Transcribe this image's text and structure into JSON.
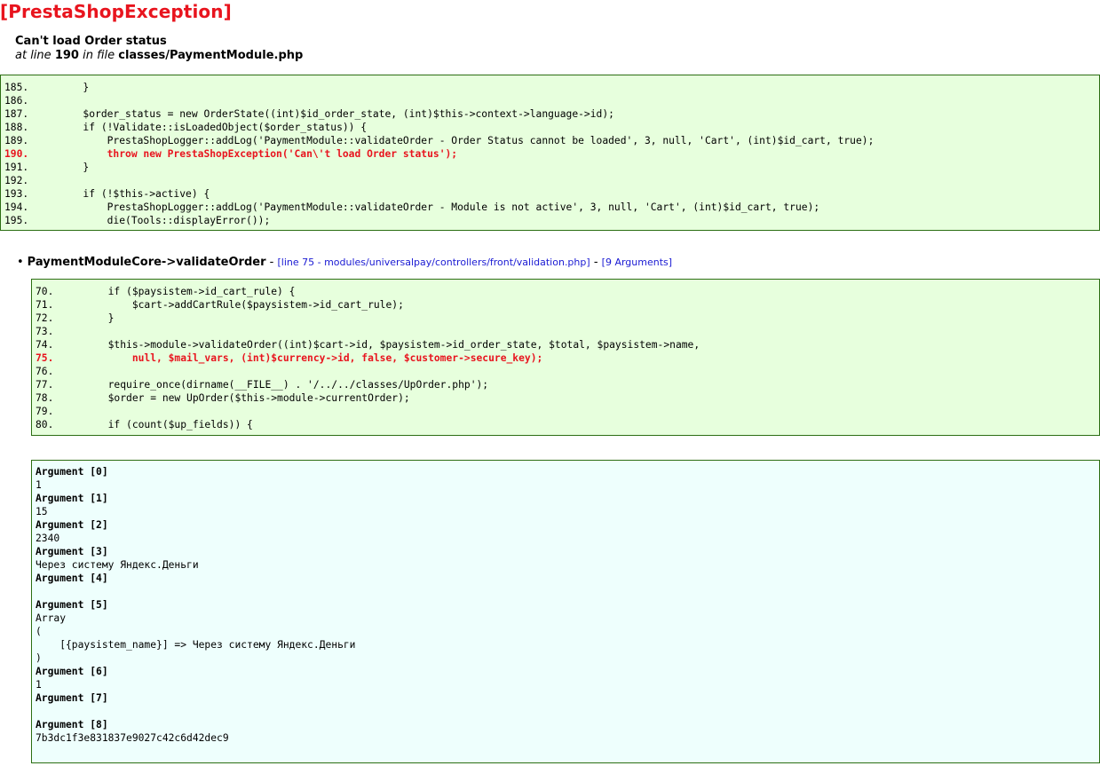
{
  "exception": {
    "title": "[PrestaShopException]",
    "message": "Can't load Order status",
    "at_line_prefix": "at line",
    "line": "190",
    "in_file_prefix": "in file",
    "file": "classes/PaymentModule.php"
  },
  "source_block_1": [
    {
      "text": "185.         }",
      "error": false
    },
    {
      "text": "186.",
      "error": false
    },
    {
      "text": "187.         $order_status = new OrderState((int)$id_order_state, (int)$this->context->language->id);",
      "error": false
    },
    {
      "text": "188.         if (!Validate::isLoadedObject($order_status)) {",
      "error": false
    },
    {
      "text": "189.             PrestaShopLogger::addLog('PaymentModule::validateOrder - Order Status cannot be loaded', 3, null, 'Cart', (int)$id_cart, true);",
      "error": false
    },
    {
      "text": "190.             throw new PrestaShopException('Can\\'t load Order status');",
      "error": true
    },
    {
      "text": "191.         }",
      "error": false
    },
    {
      "text": "192.",
      "error": false
    },
    {
      "text": "193.         if (!$this->active) {",
      "error": false
    },
    {
      "text": "194.             PrestaShopLogger::addLog('PaymentModule::validateOrder - Module is not active', 3, null, 'Cart', (int)$id_cart, true);",
      "error": false
    },
    {
      "text": "195.             die(Tools::displayError());",
      "error": false
    }
  ],
  "trace": {
    "bullet": "•",
    "function": "PaymentModuleCore->validateOrder",
    "separator": "-",
    "location": "[line 75 - modules/universalpay/controllers/front/validation.php]",
    "separator2": "-",
    "arguments_link": "[9 Arguments]"
  },
  "source_block_2": [
    {
      "text": "70.         if ($paysistem->id_cart_rule) {",
      "error": false
    },
    {
      "text": "71.             $cart->addCartRule($paysistem->id_cart_rule);",
      "error": false
    },
    {
      "text": "72.         }",
      "error": false
    },
    {
      "text": "73.",
      "error": false
    },
    {
      "text": "74.         $this->module->validateOrder((int)$cart->id, $paysistem->id_order_state, $total, $paysistem->name,",
      "error": false
    },
    {
      "text": "75.             null, $mail_vars, (int)$currency->id, false, $customer->secure_key);",
      "error": true
    },
    {
      "text": "76.",
      "error": false
    },
    {
      "text": "77.         require_once(dirname(__FILE__) . '/../../classes/UpOrder.php');",
      "error": false
    },
    {
      "text": "78.         $order = new UpOrder($this->module->currentOrder);",
      "error": false
    },
    {
      "text": "79.",
      "error": false
    },
    {
      "text": "80.         if (count($up_fields)) {",
      "error": false
    }
  ],
  "arguments": [
    {
      "label": "Argument [0]",
      "value": "1"
    },
    {
      "label": "Argument [1]",
      "value": "15"
    },
    {
      "label": "Argument [2]",
      "value": "2340"
    },
    {
      "label": "Argument [3]",
      "value": "Через систему Яндекс.Деньги"
    },
    {
      "label": "Argument [4]",
      "value": ""
    },
    {
      "label": "Argument [5]",
      "value": "Array\n(\n    [{paysistem_name}] => Через систему Яндекс.Деньги\n)\n"
    },
    {
      "label": "Argument [6]",
      "value": "1"
    },
    {
      "label": "Argument [7]",
      "value": ""
    },
    {
      "label": "Argument [8]",
      "value": "7b3dc1f3e831837e9027c42c6d42dec9"
    }
  ]
}
